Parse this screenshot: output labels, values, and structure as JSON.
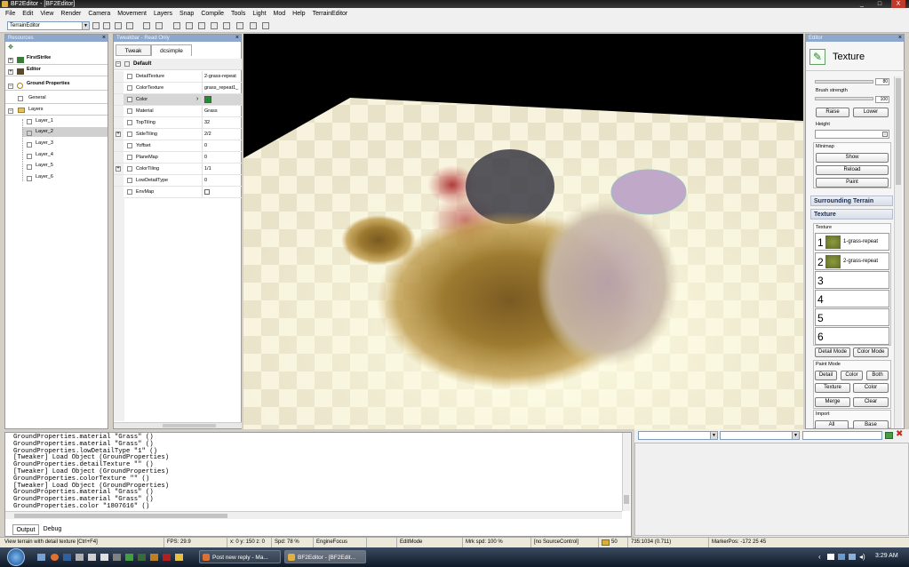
{
  "window": {
    "title": "BF2Editor - [BF2Editor]",
    "controls": [
      "_",
      "□",
      "X"
    ]
  },
  "menu": [
    "File",
    "Edit",
    "View",
    "Render",
    "Camera",
    "Movement",
    "Layers",
    "Snap",
    "Compile",
    "Tools",
    "Light",
    "Mod",
    "Help",
    "TerrainEditor"
  ],
  "toolbar": {
    "editor_select": "TerrainEditor"
  },
  "resources": {
    "title": "Resources",
    "items": [
      {
        "label": "FirstStrike",
        "bold": true
      },
      {
        "label": "Editor",
        "bold": true
      },
      {
        "label": "Ground Properties",
        "bold": true
      },
      {
        "label": "General"
      },
      {
        "label": "Layers"
      },
      {
        "label": "Layer_1"
      },
      {
        "label": "Layer_2"
      },
      {
        "label": "Layer_3"
      },
      {
        "label": "Layer_4"
      },
      {
        "label": "Layer_5"
      },
      {
        "label": "Layer_6"
      }
    ]
  },
  "tweaker": {
    "title": "Tweakbar - Read Only",
    "tabs": [
      "Tweak",
      "dcsimple"
    ],
    "group": "Default",
    "properties": [
      {
        "name": "DetailTexture",
        "value": "2-grass-repeat"
      },
      {
        "name": "ColorTexture",
        "value": "grass_repeat1_"
      },
      {
        "name": "Color",
        "value": ""
      },
      {
        "name": "Material",
        "value": "Grass"
      },
      {
        "name": "TopTiling",
        "value": "32"
      },
      {
        "name": "SideTiling",
        "value": "2/2"
      },
      {
        "name": "Yoffset",
        "value": "0"
      },
      {
        "name": "PlaneMap",
        "value": "0"
      },
      {
        "name": "ColorTiling",
        "value": "1/1"
      },
      {
        "name": "LowDetailType",
        "value": "0"
      },
      {
        "name": "EnvMap",
        "value": ""
      }
    ],
    "color_swatch": "#1e8f2e"
  },
  "editor": {
    "title": "Editor",
    "heading": "Texture",
    "brush_size_value": "80",
    "brush_strength_label": "Brush strength",
    "brush_strength_value": "100",
    "raise": "Raise",
    "lower": "Lower",
    "height_label": "Height",
    "minimap_label": "Minimap",
    "show": "Show",
    "reload": "Reload",
    "paint": "Paint",
    "surrounding_terrain": "Surrounding Terrain",
    "texture_section": "Texture",
    "texture_label": "Texture",
    "slots": [
      {
        "num": "1",
        "name": "1-grass-repeat",
        "thumb": true
      },
      {
        "num": "2",
        "name": "2-grass-repeat",
        "thumb": true
      },
      {
        "num": "3",
        "name": "",
        "thumb": false
      },
      {
        "num": "4",
        "name": "",
        "thumb": false
      },
      {
        "num": "5",
        "name": "",
        "thumb": false
      },
      {
        "num": "6",
        "name": "",
        "thumb": false
      }
    ],
    "detail_mode": "Detail Mode",
    "color_mode": "Color Mode",
    "paint_mode_label": "Paint Mode",
    "pm_detail": "Detail",
    "pm_color": "Color",
    "pm_both": "Both",
    "texture_btn": "Texture",
    "color_btn": "Color",
    "merge": "Merge",
    "clear": "Clear",
    "import_label": "Import",
    "import_all": "All",
    "import_base": "Base"
  },
  "output": {
    "lines": [
      "GroundProperties.material \"Grass\" ()",
      "GroundProperties.material \"Grass\" ()",
      "GroundProperties.lowDetailType \"1\" ()",
      "[Tweaker] Load Object (GroundProperties)",
      "GroundProperties.detailTexture \"\" ()",
      "[Tweaker] Load Object (GroundProperties)",
      "GroundProperties.colorTexture \"\" ()",
      "[Tweaker] Load Object (GroundProperties)",
      "GroundProperties.material \"Grass\" ()",
      "GroundProperties.material \"Grass\" ()",
      "GroundProperties.color \"1807616\" ()"
    ],
    "tabs": [
      "Output",
      "Debug"
    ]
  },
  "statusbar": {
    "hint": "View terrain with detail texture [Ctrl+F4]",
    "fps": "FPS: 29.9",
    "coords": "x: 0 y: 150 z: 0",
    "spd": "Spd: 78 %",
    "engine": "EngineFocus",
    "mode": "EditMode",
    "mrk": "Mrk spd: 100 %",
    "source": "[no SourceControl]",
    "count": "50",
    "pos": "735:1034 (0.711)",
    "marker": "MarkerPos: -172 25 45"
  },
  "taskbar": {
    "tasks": [
      "Post new reply - Ma...",
      "BF2Editor - [BF2Edit..."
    ],
    "clock": "3:29 AM"
  }
}
